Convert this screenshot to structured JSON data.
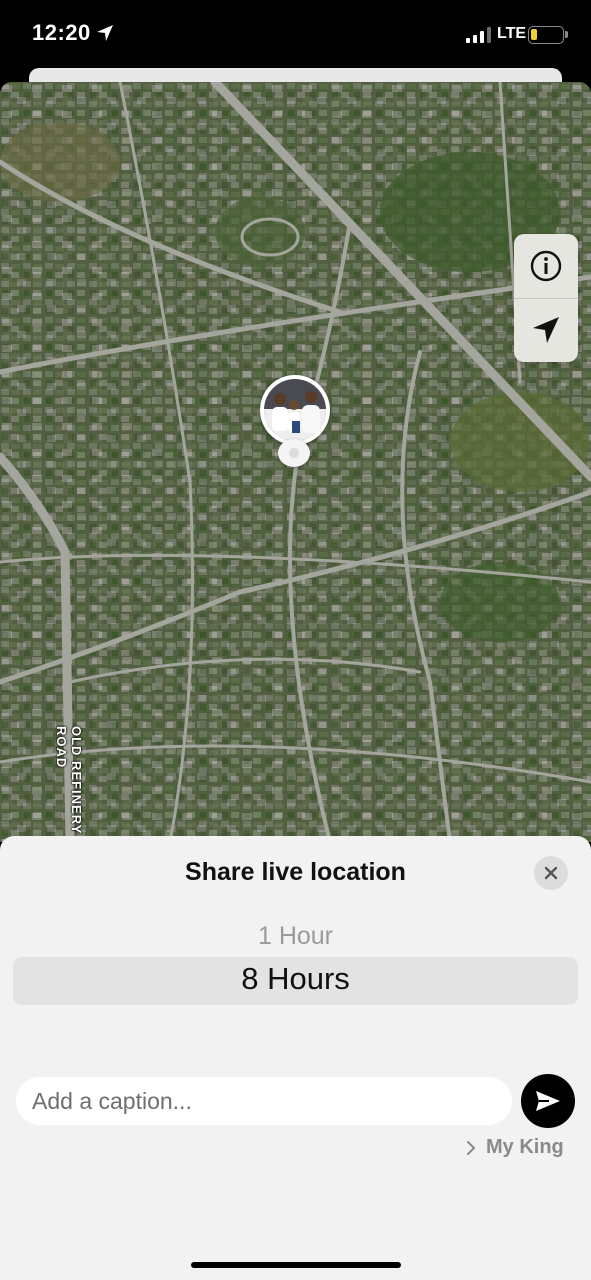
{
  "status_bar": {
    "time": "12:20",
    "network": "LTE",
    "battery_level": "17",
    "icons": [
      "location-arrow-icon",
      "signal-icon",
      "battery-icon"
    ]
  },
  "map": {
    "road_label": "OLD REFINERY ROAD",
    "controls": {
      "info_icon": "info-icon",
      "locate_icon": "location-arrow-icon"
    },
    "colors": {
      "satellite_base": "#4e5a3c",
      "road": "#9a9c95",
      "vegetation": "#3f5e2c"
    }
  },
  "share_panel": {
    "title": "Share live location",
    "durations": {
      "previous": "1 Hour",
      "selected": "8 Hours"
    },
    "caption_placeholder": "Add a caption...",
    "recipient": "My King",
    "icons": [
      "close-icon",
      "send-icon",
      "chevron-right-icon"
    ]
  }
}
